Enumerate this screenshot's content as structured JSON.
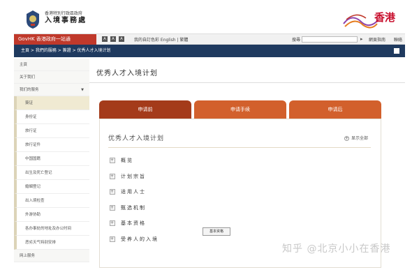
{
  "header": {
    "dept_line1": "香港特別行政區政府",
    "dept_line2": "入境事務處",
    "brand_text": "香港"
  },
  "govbar": {
    "logo_text": "GovHK 香港政府一站通",
    "links": "我的自訂色彩  English | 繁體",
    "search_label": "搜尋",
    "sitemap": "網頁指南",
    "contact": "聯絡"
  },
  "breadcrumb": "主頁 > 我們的服務 > 簽證 > 优秀人才入境计划",
  "sidebar": {
    "top_items": [
      "主頁",
      "关于我们",
      "我们的服务"
    ],
    "sub_items": [
      "簽证",
      "身份证",
      "旅行证",
      "旅行证件",
      "中国国籍",
      "出生及死亡登记",
      "婚姻登记",
      "出入境检查",
      "外游协助",
      "各办事处的地址及办公时间",
      "恶劣天气特别安排"
    ],
    "bottom_item": "网上服务"
  },
  "main": {
    "page_title": "优秀人才入境计划",
    "tabs": [
      "申请前",
      "申请手续",
      "申请后"
    ],
    "panel_title": "优秀人才入境计划",
    "show_all": "显示全部",
    "items": [
      "概览",
      "计划宗旨",
      "适用人士",
      "甄选机制",
      "基本资格",
      "受养人的入境"
    ],
    "tooltip": "基本资格"
  },
  "watermark": "知乎 @北京小小在香港",
  "colors": {
    "tab_active": "#a43b1a",
    "tab_inactive": "#d2602c",
    "breadcrumb_bg": "#1f3a5f",
    "brand_red": "#c8102e"
  }
}
